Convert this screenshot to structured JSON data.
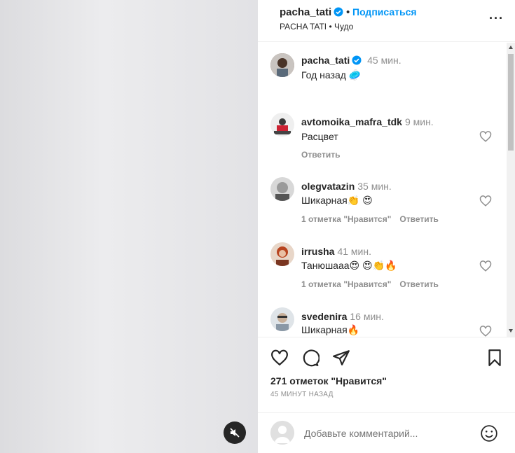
{
  "header": {
    "username": "pacha_tati",
    "separator": "•",
    "follow_label": "Подписаться",
    "subtitle": "PACHA TATI • Чудо",
    "more_label": "···"
  },
  "caption": {
    "username": "pacha_tati",
    "time": "45 мин.",
    "text": "Год назад 🥏"
  },
  "comments": [
    {
      "username": "avtomoika_mafra_tdk",
      "time": "9 мин.",
      "text": "Расцвет",
      "likes": "",
      "reply": "Ответить"
    },
    {
      "username": "olegvatazin",
      "time": "35 мин.",
      "text": "Шикарная👏 😍",
      "likes": "1 отметка \"Нравится\"",
      "reply": "Ответить"
    },
    {
      "username": "irrusha",
      "time": "41 мин.",
      "text": "Танюшааа😍 😍👏🔥",
      "likes": "1 отметка \"Нравится\"",
      "reply": "Ответить"
    },
    {
      "username": "svedenira",
      "time": "16 мин.",
      "text": "Шикарная🔥",
      "likes": "",
      "reply": ""
    }
  ],
  "footer": {
    "likes_text": "271 отметок \"Нравится\"",
    "time_ago": "45 МИНУТ НАЗАД",
    "add_comment_placeholder": "Добавьте комментарий..."
  },
  "colors": {
    "accent": "#0095f6",
    "text": "#262626",
    "muted": "#8e8e8e"
  }
}
